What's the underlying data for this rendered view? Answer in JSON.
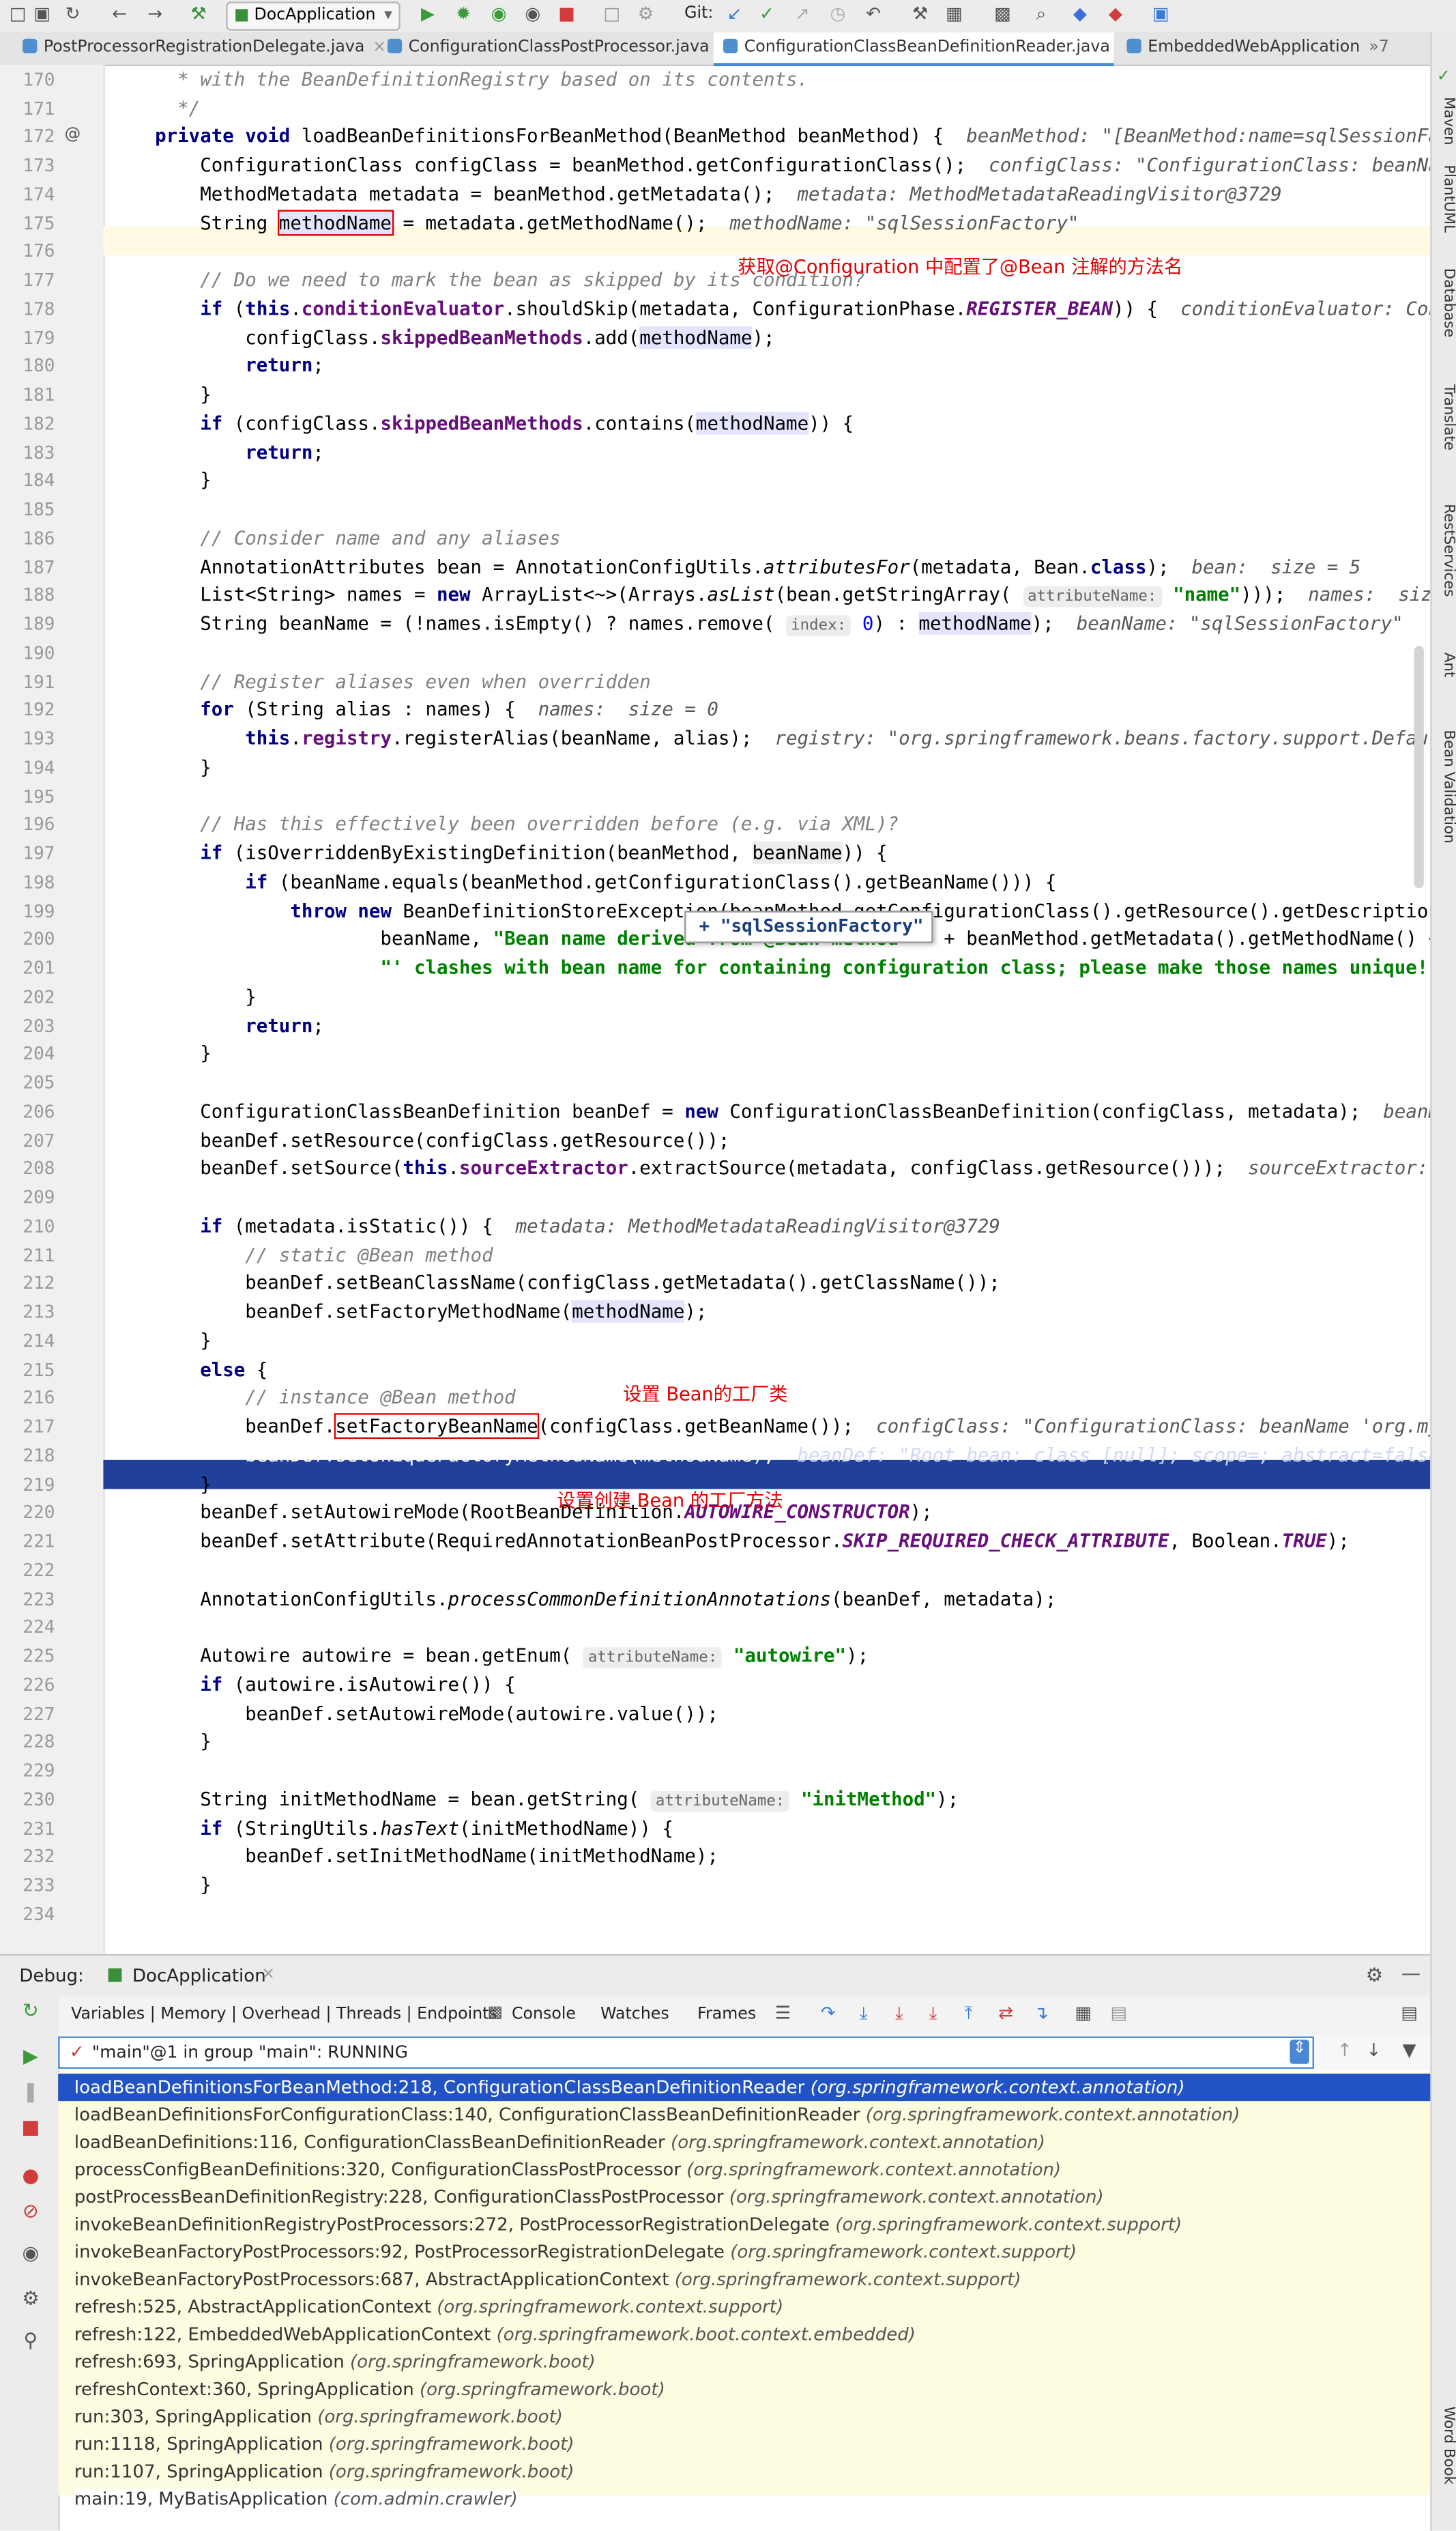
{
  "toolbar": {
    "run_config": "DocApplication",
    "git_label": "Git:"
  },
  "tabs": [
    {
      "label": "PostProcessorRegistrationDelegate.java"
    },
    {
      "label": "ConfigurationClassPostProcessor.java"
    },
    {
      "label": "ConfigurationClassBeanDefinitionReader.java"
    },
    {
      "label": "EmbeddedWebApplicationC"
    }
  ],
  "tab_overflow": "»7",
  "tooltip": {
    "text": "+ \"sqlSessionFactory\""
  },
  "annotations": {
    "line175": "获取@Configuration 中配置了@Bean 注解的方法名",
    "line215": "设置 Bean的工厂类",
    "line219": "设置创建 Bean 的工厂方法"
  },
  "right_tools": [
    "Maven",
    "PlantUML",
    "Database",
    "Translate",
    "RestServices",
    "Ant",
    "Bean Validation",
    "Word Book"
  ],
  "debug": {
    "title": "Debug:",
    "config": "DocApplication",
    "tabs": [
      "Variables | Memory | Overhead | Threads | Endpoints",
      "Console",
      "Watches",
      "Frames"
    ],
    "thread": "\"main\"@1 in group \"main\": RUNNING"
  },
  "frames": [
    {
      "m": "loadBeanDefinitionsForBeanMethod:218, ConfigurationClassBeanDefinitionReader",
      "p": "(org.springframework.context.annotation)"
    },
    {
      "m": "loadBeanDefinitionsForConfigurationClass:140, ConfigurationClassBeanDefinitionReader",
      "p": "(org.springframework.context.annotation)"
    },
    {
      "m": "loadBeanDefinitions:116, ConfigurationClassBeanDefinitionReader",
      "p": "(org.springframework.context.annotation)"
    },
    {
      "m": "processConfigBeanDefinitions:320, ConfigurationClassPostProcessor",
      "p": "(org.springframework.context.annotation)"
    },
    {
      "m": "postProcessBeanDefinitionRegistry:228, ConfigurationClassPostProcessor",
      "p": "(org.springframework.context.annotation)"
    },
    {
      "m": "invokeBeanDefinitionRegistryPostProcessors:272, PostProcessorRegistrationDelegate",
      "p": "(org.springframework.context.support)"
    },
    {
      "m": "invokeBeanFactoryPostProcessors:92, PostProcessorRegistrationDelegate",
      "p": "(org.springframework.context.support)"
    },
    {
      "m": "invokeBeanFactoryPostProcessors:687, AbstractApplicationContext",
      "p": "(org.springframework.context.support)"
    },
    {
      "m": "refresh:525, AbstractApplicationContext",
      "p": "(org.springframework.context.support)"
    },
    {
      "m": "refresh:122, EmbeddedWebApplicationContext",
      "p": "(org.springframework.boot.context.embedded)"
    },
    {
      "m": "refresh:693, SpringApplication",
      "p": "(org.springframework.boot)"
    },
    {
      "m": "refreshContext:360, SpringApplication",
      "p": "(org.springframework.boot)"
    },
    {
      "m": "run:303, SpringApplication",
      "p": "(org.springframework.boot)"
    },
    {
      "m": "run:1118, SpringApplication",
      "p": "(org.springframework.boot)"
    },
    {
      "m": "run:1107, SpringApplication",
      "p": "(org.springframework.boot)"
    },
    {
      "m": "main:19, MyBatisApplication",
      "p": "(com.admin.crawler)"
    }
  ]
}
